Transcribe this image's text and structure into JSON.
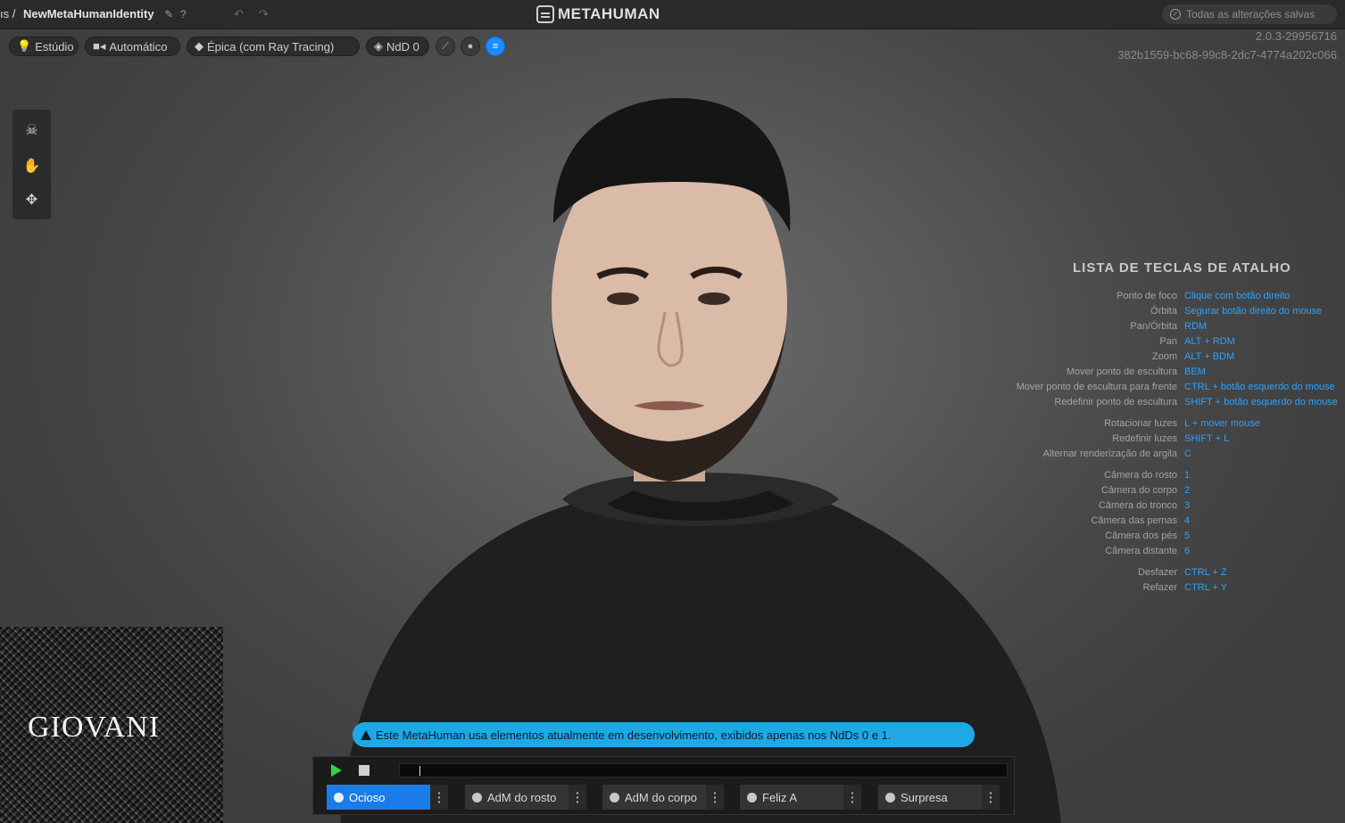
{
  "topbar": {
    "breadcrumb_prefix": "ıs /",
    "asset_name": "NewMetaHumanIdentity",
    "logo_text": "METAHUMAN",
    "saved_status": "Todas as alterações salvas"
  },
  "toolbar": {
    "lighting": "Estúdio",
    "camera": "Automático",
    "quality": "Épica (com Ray Tracing)",
    "lod": "NdD 0"
  },
  "version": {
    "number": "2.0.3-29956716",
    "guid": "382b1559-bc68-99c8-2dc7-4774a202c066"
  },
  "shortcuts": {
    "title": "LISTA DE TECLAS DE ATALHO",
    "rows": [
      {
        "label": "Ponto de foco",
        "key": "Clique com botão direito"
      },
      {
        "label": "Órbita",
        "key": "Segurar botão direito do mouse"
      },
      {
        "label": "Pan/Órbita",
        "key": "RDM"
      },
      {
        "label": "Pan",
        "key": "ALT + RDM"
      },
      {
        "label": "Zoom",
        "key": "ALT + BDM"
      },
      {
        "label": "Mover ponto de escultura",
        "key": "BEM"
      },
      {
        "label": "Mover ponto de escultura para frente",
        "key": "CTRL + botão esquerdo do mouse"
      },
      {
        "label": "Redefinir ponto de escultura",
        "key": "SHIFT + botão esquerdo do mouse"
      },
      {
        "label": "Rotacionar luzes",
        "key": "L + mover mouse"
      },
      {
        "label": "Redefinir luzes",
        "key": "SHIFT + L"
      },
      {
        "label": "Alternar renderização de argila",
        "key": "C"
      },
      {
        "label": "Câmera do rosto",
        "key": "1"
      },
      {
        "label": "Câmera do corpo",
        "key": "2"
      },
      {
        "label": "Câmera do tronco",
        "key": "3"
      },
      {
        "label": "Câmera das pernas",
        "key": "4"
      },
      {
        "label": "Câmera dos pés",
        "key": "5"
      },
      {
        "label": "Câmera distante",
        "key": "6"
      },
      {
        "label": "Desfazer",
        "key": "CTRL + Z"
      },
      {
        "label": "Refazer",
        "key": "CTRL + Y"
      }
    ]
  },
  "watermark": "GIOVANI",
  "banner": {
    "text": "Este MetaHuman usa elementos atualmente em desenvolvimento, exibidos apenas nos NdDs 0 e 1."
  },
  "animation": {
    "items": [
      {
        "label": "Ocioso",
        "active": true
      },
      {
        "label": "AdM do rosto",
        "active": false
      },
      {
        "label": "AdM do corpo",
        "active": false
      },
      {
        "label": "Feliz A",
        "active": false
      },
      {
        "label": "Surpresa",
        "active": false
      }
    ]
  },
  "colors": {
    "accent": "#1a7ce8",
    "banner": "#1fa8e6",
    "shortcut_key": "#2aa3ff",
    "play": "#2fd34a"
  }
}
